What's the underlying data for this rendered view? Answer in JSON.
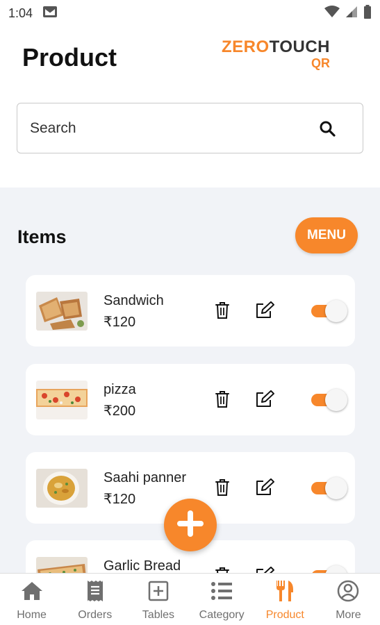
{
  "status_bar": {
    "time": "1:04"
  },
  "header": {
    "title": "Product",
    "logo_zero": "ZERO",
    "logo_touch": "TOUCH",
    "logo_qr": "QR"
  },
  "search": {
    "placeholder": "Search",
    "value": ""
  },
  "items_section": {
    "title": "Items",
    "menu_label": "MENU"
  },
  "products": [
    {
      "name": "Sandwich",
      "price": "₹120",
      "enabled": true,
      "image": "sandwich"
    },
    {
      "name": "pizza",
      "price": "₹200",
      "enabled": true,
      "image": "pizza"
    },
    {
      "name": "Saahi panner",
      "price": "₹120",
      "enabled": true,
      "image": "curry"
    },
    {
      "name": "Garlic Bread",
      "price": "",
      "enabled": true,
      "image": "garlic-bread"
    }
  ],
  "bottom_nav": [
    {
      "label": "Home",
      "icon": "home-icon",
      "active": false
    },
    {
      "label": "Orders",
      "icon": "receipt-icon",
      "active": false
    },
    {
      "label": "Tables",
      "icon": "plus-square-icon",
      "active": false
    },
    {
      "label": "Category",
      "icon": "list-icon",
      "active": false
    },
    {
      "label": "Product",
      "icon": "cutlery-icon",
      "active": true
    },
    {
      "label": "More",
      "icon": "user-circle-icon",
      "active": false
    }
  ],
  "colors": {
    "accent": "#f7872b",
    "background": "#f1f3f7",
    "card": "#ffffff",
    "nav_inactive": "#6f6f6f"
  }
}
